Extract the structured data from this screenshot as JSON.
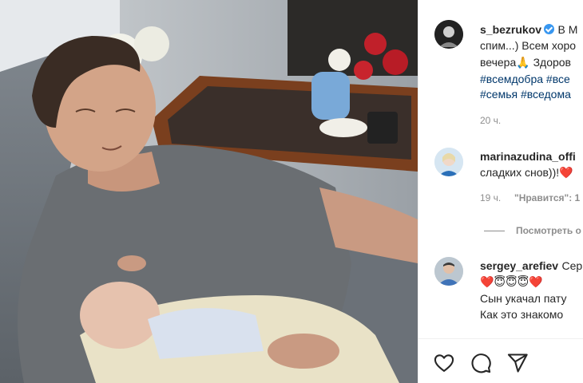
{
  "post": {
    "username": "s_bezrukov",
    "caption_line1": "В М",
    "caption_line2": "спим...) Всем хоро",
    "caption_line3": "вечера🙏 Здоров",
    "hashtags_line1": "#всемдобра #все",
    "hashtags_line2": "#семья #вседома",
    "time": "20 ч."
  },
  "comments": [
    {
      "username": "marinazudina_offi",
      "text": "сладких снов))!❤️",
      "time": "19 ч.",
      "likes": "\"Нравится\": 1"
    },
    {
      "username": "sergey_arefiev",
      "text_inline": "Сер",
      "emoji_line": "❤️😇😇😇❤️",
      "line2": "Сын укачал пату",
      "line3": "Как это знакомо"
    }
  ],
  "view_replies": "Посмотреть о",
  "icons": [
    "verified-badge-icon",
    "heart-icon",
    "comment-icon",
    "share-icon"
  ],
  "colors": {
    "hashtag": "#00376b",
    "verified": "#3897f0",
    "heart": "#ed4956",
    "meta": "#8e8e8e"
  }
}
